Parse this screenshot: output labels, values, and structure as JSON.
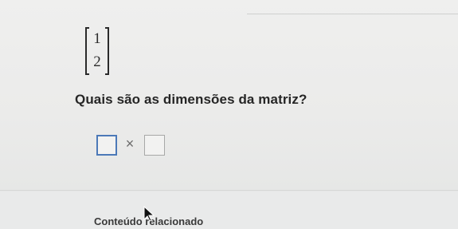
{
  "problem": {
    "matrix": {
      "entries": [
        "1",
        "2"
      ]
    },
    "question": "Quais são as dimensões da matriz?",
    "answer": {
      "rows_value": "",
      "times_symbol": "×",
      "cols_value": ""
    }
  },
  "related_content": {
    "label": "Conteúdo relacionado"
  },
  "cursor": {
    "icon": "mouse-pointer-icon"
  },
  "colors": {
    "background": "#ebebea",
    "active_box_border": "#4c79b8",
    "inactive_box_border": "#a7a8a7",
    "text": "#262626"
  }
}
